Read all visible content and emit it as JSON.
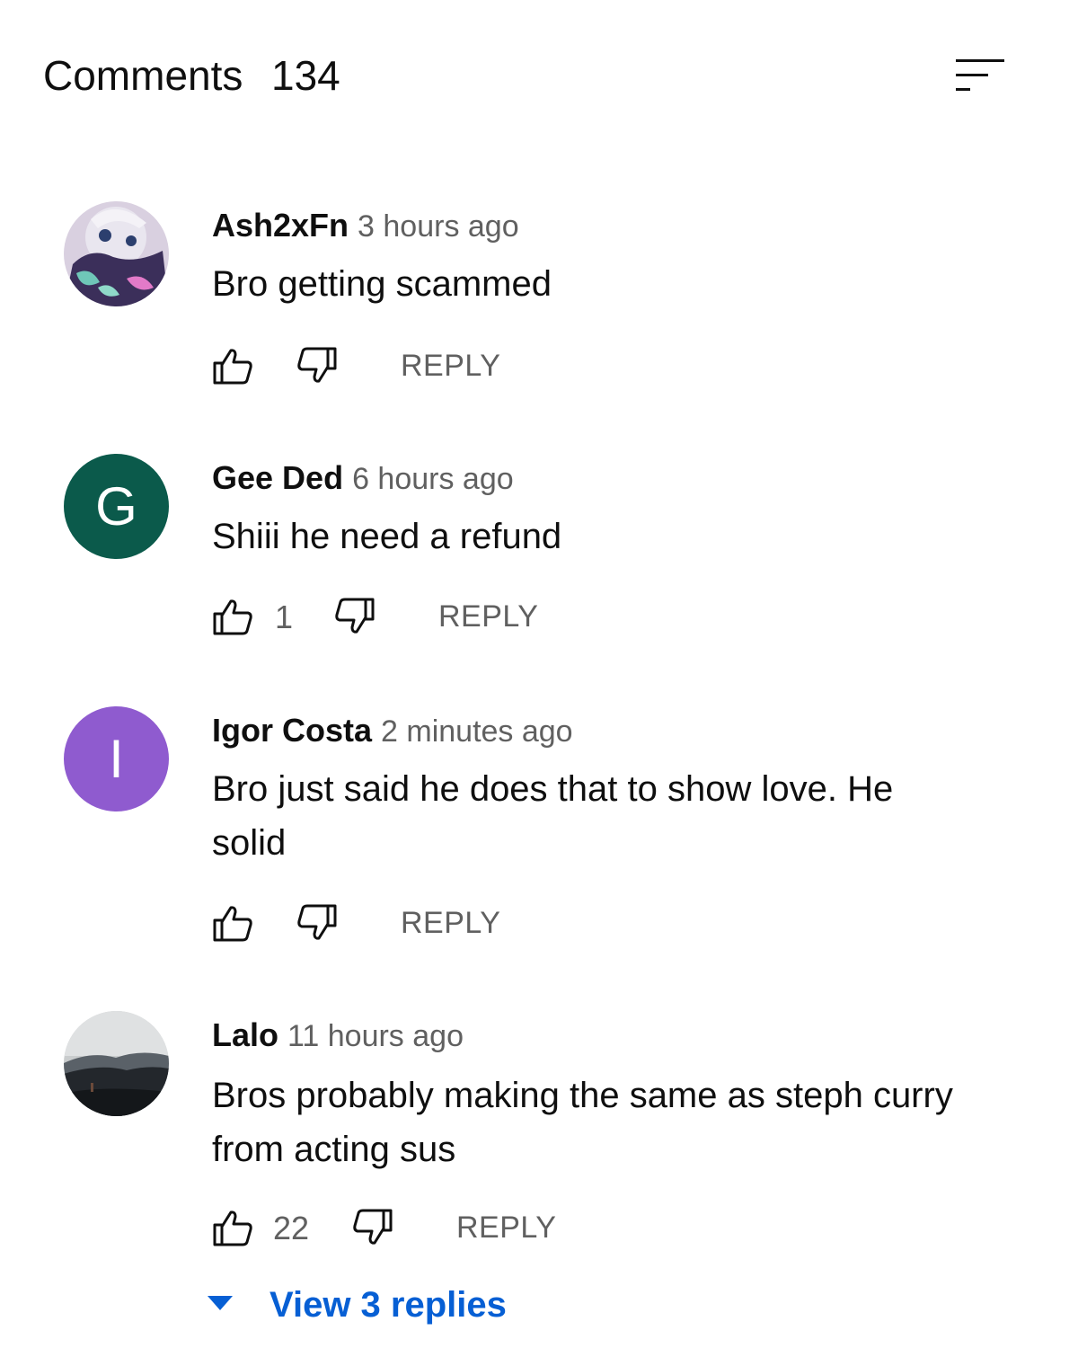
{
  "header": {
    "title": "Comments",
    "count": "134",
    "sort_icon": "sort-icon"
  },
  "comments": [
    {
      "author": "Ash2xFn",
      "time": "3 hours ago",
      "text": "Bro getting scammed",
      "likes": "",
      "reply_label": "REPLY",
      "avatar": {
        "type": "image",
        "letter": ""
      }
    },
    {
      "author": "Gee Ded",
      "time": "6 hours ago",
      "text": "Shiii he need a refund",
      "likes": "1",
      "reply_label": "REPLY",
      "avatar": {
        "type": "letter",
        "letter": "G",
        "color": "#0b5a4b"
      }
    },
    {
      "author": "Igor Costa",
      "time": "2 minutes ago",
      "text": "Bro just said he does that to show love. He solid",
      "likes": "",
      "reply_label": "REPLY",
      "avatar": {
        "type": "letter",
        "letter": "I",
        "color": "#8f5bcf"
      }
    },
    {
      "author": "Lalo",
      "time": "11 hours ago",
      "text": "Bros probably making the same as steph curry from acting sus",
      "likes": "22",
      "reply_label": "REPLY",
      "avatar": {
        "type": "image",
        "letter": ""
      }
    }
  ],
  "view_replies": {
    "label": "View 3 replies",
    "color": "#065fd4"
  },
  "colors": {
    "text": "#0f0f0f",
    "secondary": "#606060",
    "link": "#065fd4"
  }
}
